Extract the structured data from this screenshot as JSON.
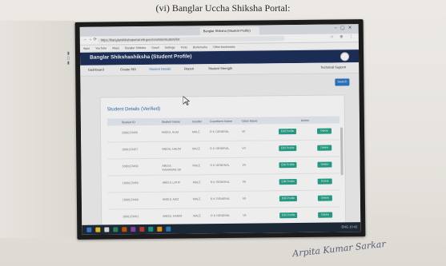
{
  "document": {
    "heading": "(vi) Banglar Uccha Shiksha Portal:",
    "signature": "Arpita Kumar Sarkar"
  },
  "browser": {
    "tab_title": "Banglar Shiksha (Student Profile)",
    "url": "https://banglarshikshaportal.wb.gov.in/online/student/list",
    "bookmarks": [
      "Apps",
      "YouTube",
      "Maps",
      "Banglar Shiksha",
      "Gmail",
      "Settings",
      "Tools",
      "Bookmarks",
      "Other bookmarks"
    ]
  },
  "app": {
    "title": "Banglar Shikshashiksha (Student Profile)",
    "nav": [
      "Dashboard",
      "Create SID",
      "Student Details",
      "Report",
      "Student Strength"
    ],
    "support": "Technical Support",
    "search_button": "Search"
  },
  "panel": {
    "title": "Student Details (Verified)",
    "columns": [
      "Student ID",
      "Student Name",
      "Gender",
      "Guardian's Name",
      "Class Name",
      "Action"
    ],
    "rows": [
      {
        "id": "1000123456",
        "name": "ABDUL ALIM",
        "gender": "MALE",
        "guardian": "R K GENERAL",
        "class": "VII",
        "a1": "Edit Profile",
        "a2": "Delete"
      },
      {
        "id": "1000123457",
        "name": "ABDUL HALIM",
        "gender": "MALE",
        "guardian": "R K GENERAL",
        "class": "VII",
        "a1": "Edit Profile",
        "a2": "Delete"
      },
      {
        "id": "1000123458",
        "name": "ABDUL RAHAMAN SK",
        "gender": "MALE",
        "guardian": "R K GENERAL",
        "class": "VII",
        "a1": "Edit Profile",
        "a2": "Delete"
      },
      {
        "id": "1000123459",
        "name": "ABDUL LATIF",
        "gender": "MALE",
        "guardian": "R K GENERAL",
        "class": "VII",
        "a1": "Edit Profile",
        "a2": "Delete"
      },
      {
        "id": "1000123460",
        "name": "ABDUL AZIZ",
        "gender": "MALE",
        "guardian": "R K GENERAL",
        "class": "VII",
        "a1": "Edit Profile",
        "a2": "Delete"
      },
      {
        "id": "1000123461",
        "name": "ABDUL KARIM",
        "gender": "MALE",
        "guardian": "R K GENERAL",
        "class": "VII",
        "a1": "Edit Profile",
        "a2": "Delete"
      }
    ]
  },
  "colors": {
    "app_header": "#1b2e5a",
    "action_button": "#25a38a",
    "search_button": "#2a76c6",
    "panel_title": "#2d6fb3"
  },
  "taskbar": {
    "tray": "ENG 10:42"
  }
}
